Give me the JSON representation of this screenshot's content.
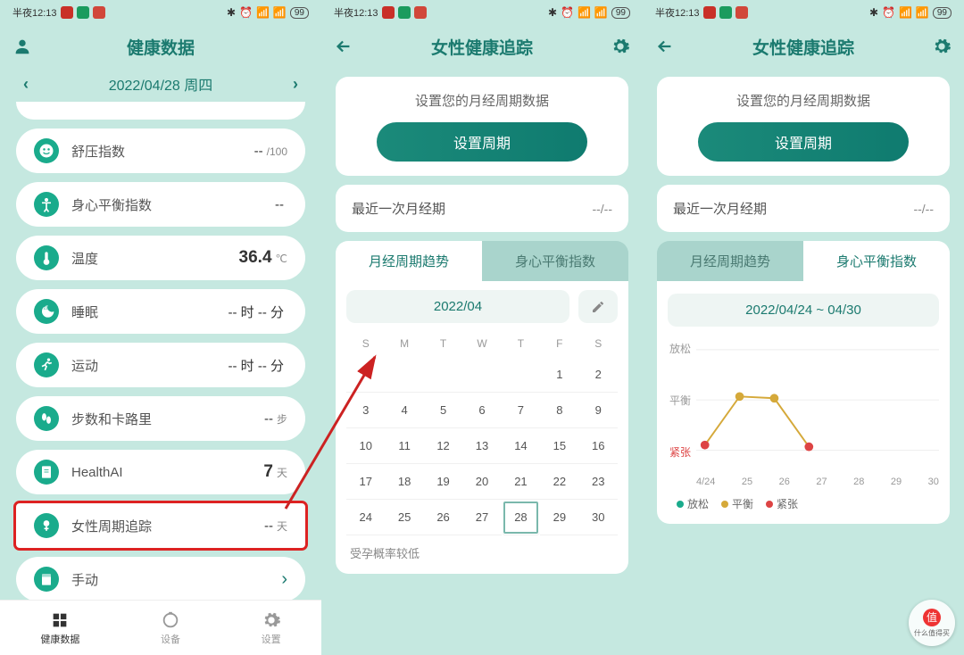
{
  "statusbar": {
    "time": "半夜12:13",
    "battery": "99"
  },
  "screen1": {
    "title": "健康数据",
    "date": "2022/04/28 周四",
    "items": [
      {
        "label": "舒压指数",
        "value": "--",
        "unit": "/100",
        "icon": "smile"
      },
      {
        "label": "身心平衡指数",
        "value": "--",
        "unit": "",
        "icon": "person"
      },
      {
        "label": "温度",
        "value": "36.4",
        "unit": "℃",
        "icon": "therm",
        "big": true
      },
      {
        "label": "睡眠",
        "value": "-- 时 -- 分",
        "unit": "",
        "icon": "moon"
      },
      {
        "label": "运动",
        "value": "-- 时 -- 分",
        "unit": "",
        "icon": "run"
      },
      {
        "label": "步数和卡路里",
        "value": "--",
        "unit": "步",
        "icon": "steps"
      },
      {
        "label": "HealthAI",
        "value": "7",
        "unit": "天",
        "icon": "doc",
        "big": true
      },
      {
        "label": "女性周期追踪",
        "value": "--",
        "unit": "天",
        "icon": "female",
        "highlight": true
      },
      {
        "label": "手动",
        "value": "",
        "unit": "",
        "icon": "book",
        "chevron": true
      }
    ],
    "nav": [
      {
        "label": "健康数据",
        "active": true
      },
      {
        "label": "设备",
        "active": false
      },
      {
        "label": "设置",
        "active": false
      }
    ]
  },
  "screen2": {
    "title": "女性健康追踪",
    "setup_prompt": "设置您的月经周期数据",
    "setup_button": "设置周期",
    "last_period_label": "最近一次月经期",
    "last_period_value": "--/--",
    "tabs": [
      "月经周期趋势",
      "身心平衡指数"
    ],
    "active_tab": 0,
    "month": "2022/04",
    "dow": [
      "S",
      "M",
      "T",
      "W",
      "T",
      "F",
      "S"
    ],
    "weeks": [
      [
        "",
        "",
        "",
        "",
        "",
        "1",
        "2"
      ],
      [
        "3",
        "4",
        "5",
        "6",
        "7",
        "8",
        "9"
      ],
      [
        "10",
        "11",
        "12",
        "13",
        "14",
        "15",
        "16"
      ],
      [
        "17",
        "18",
        "19",
        "20",
        "21",
        "22",
        "23"
      ],
      [
        "24",
        "25",
        "26",
        "27",
        "28",
        "29",
        "30"
      ]
    ],
    "today": "28",
    "note": "受孕概率较低"
  },
  "screen3": {
    "title": "女性健康追踪",
    "setup_prompt": "设置您的月经周期数据",
    "setup_button": "设置周期",
    "last_period_label": "最近一次月经期",
    "last_period_value": "--/--",
    "tabs": [
      "月经周期趋势",
      "身心平衡指数"
    ],
    "active_tab": 1,
    "range": "2022/04/24 ~ 04/30",
    "ylabels": [
      "放松",
      "平衡",
      "紧张"
    ],
    "xlabels": [
      "4/24",
      "25",
      "26",
      "27",
      "28",
      "29",
      "30"
    ],
    "legend": [
      {
        "label": "放松",
        "color": "#1aab8c"
      },
      {
        "label": "平衡",
        "color": "#d5a93a"
      },
      {
        "label": "紧张",
        "color": "#d44"
      }
    ]
  },
  "chart_data": {
    "type": "line",
    "title": "身心平衡指数",
    "xlabel": "",
    "ylabel": "",
    "categories": [
      "4/24",
      "25",
      "26",
      "27",
      "28",
      "29",
      "30"
    ],
    "y_categories": [
      "紧张",
      "平衡",
      "放松"
    ],
    "series": [
      {
        "name": "index",
        "values": [
          "紧张",
          "平衡",
          "平衡",
          "紧张",
          null,
          null,
          null
        ],
        "point_colors": [
          "#d44",
          "#d5a93a",
          "#d5a93a",
          "#d44",
          null,
          null,
          null
        ]
      }
    ]
  },
  "watermark": {
    "char": "值",
    "text": "什么值得买"
  }
}
